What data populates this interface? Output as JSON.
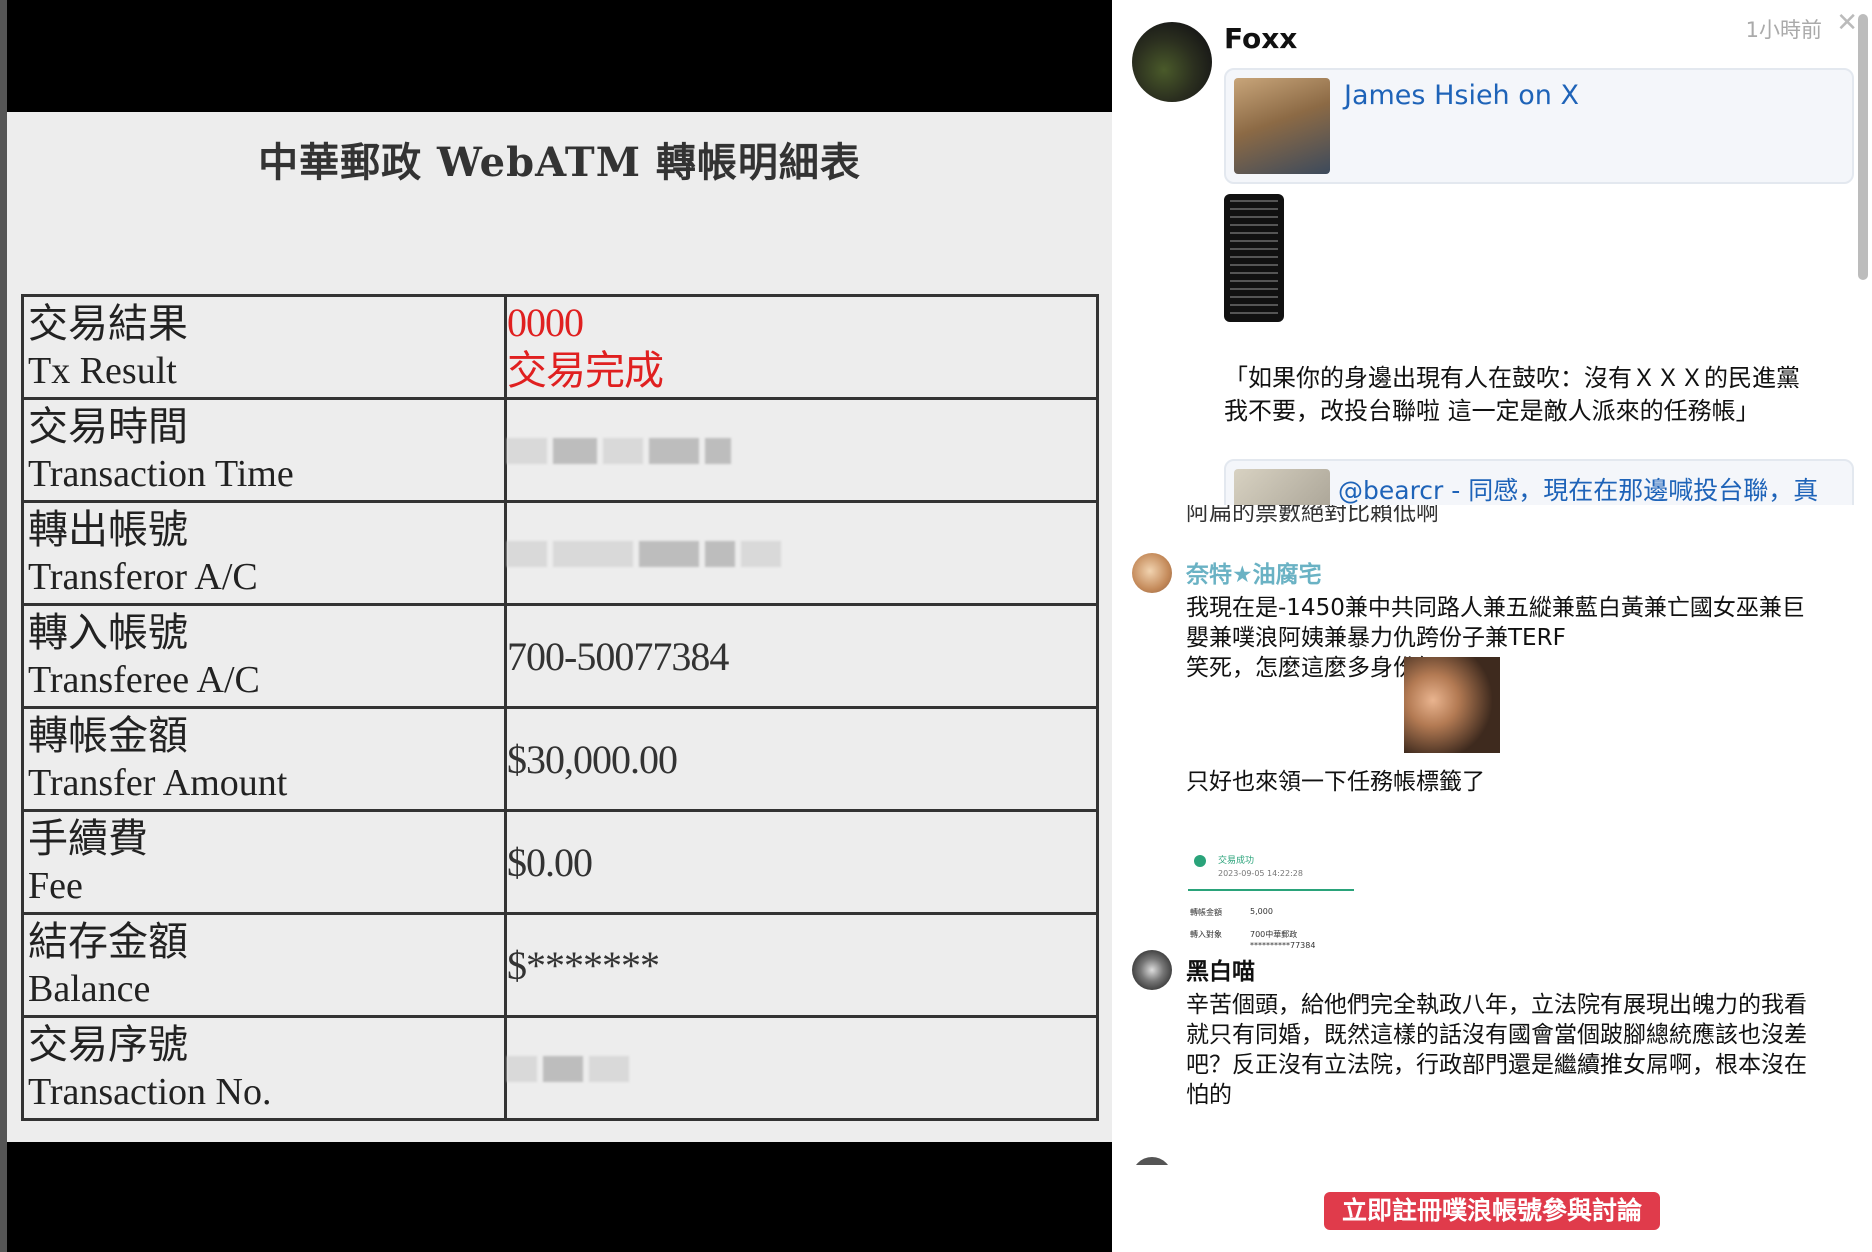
{
  "receipt": {
    "title": "中華郵政 WebATM 轉帳明細表",
    "rows": [
      {
        "label_zh": "交易結果",
        "label_en": "Tx Result",
        "value": "0000",
        "value_2": "交易完成"
      },
      {
        "label_zh": "交易時間",
        "label_en": "Transaction Time"
      },
      {
        "label_zh": "轉出帳號",
        "label_en": "Transferor A/C"
      },
      {
        "label_zh": "轉入帳號",
        "label_en": "Transferee A/C",
        "value": "700-50077384"
      },
      {
        "label_zh": "轉帳金額",
        "label_en": "Transfer Amount",
        "value": "$30,000.00"
      },
      {
        "label_zh": "手續費",
        "label_en": "Fee",
        "value": "$0.00"
      },
      {
        "label_zh": "結存金額",
        "label_en": "Balance",
        "value": "$*******"
      },
      {
        "label_zh": "交易序號",
        "label_en": "Transaction No."
      }
    ],
    "colors": {
      "success": "#e02020"
    }
  },
  "post": {
    "author": "Foxx",
    "time": "1小時前",
    "close": "✕",
    "card_1_title": "James Hsieh on X",
    "text_line_1": "「如果你的身邊出現有人在鼓吹：沒有ＸＸＸ的民進黨",
    "text_line_2": "我不要，改投台聯啦 這一定是敵人派來的任務帳」",
    "card_2_title": "@bearcr - 同感，現在在那邊喊投台聯，真"
  },
  "responses": {
    "cut_text": "阿扁的票數絕對比賴低啊",
    "items": [
      {
        "name": "奈特★油腐宅",
        "line_1": "我現在是-1450兼中共同路人兼五縱兼藍白黃兼亡國女巫兼巨",
        "line_2": "嬰兼噗浪阿姨兼暴力仇跨份子兼TERF",
        "line_3": "笑死，怎麼這麼多身份組",
        "line_4": "只好也來領一下任務帳標籤了",
        "receipt_shot": {
          "status": "交易成功",
          "date": "2023-09-05 14:22:28",
          "amount_label": "轉帳金額",
          "amount": "5,000",
          "target_label": "轉入對象",
          "target": "700中華郵政",
          "account": "**********77384"
        }
      },
      {
        "name": "黑白喵",
        "line_1": "辛苦個頭，給他們完全執政八年，立法院有展現出魄力的我看",
        "line_2": "就只有同婚，既然這樣的話沒有國會當個跛腳總統應該也沒差",
        "line_3": "吧？反正沒有立法院，行政部門還是繼續推女屌啊，根本沒在",
        "line_4": "怕的"
      }
    ]
  },
  "register_button": "立即註冊噗浪帳號參與討論",
  "colors": {
    "link": "#1e63b8",
    "register": "#e03b4b",
    "name_teal": "#6ab2c4"
  }
}
